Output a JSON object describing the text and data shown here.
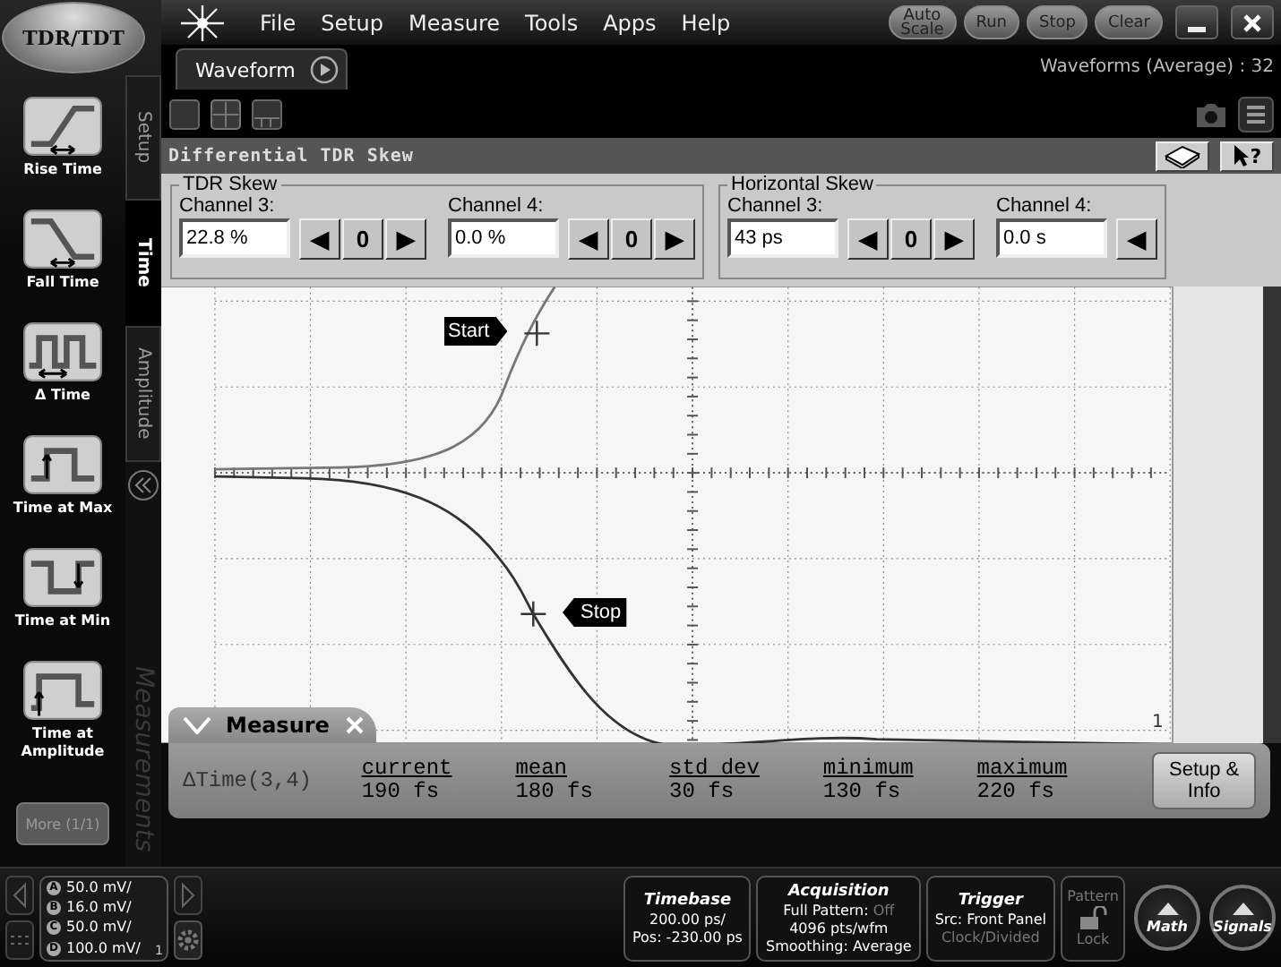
{
  "app_button": "TDR/TDT",
  "menu": [
    "File",
    "Setup",
    "Measure",
    "Tools",
    "Apps",
    "Help"
  ],
  "run_controls": [
    "Auto Scale",
    "Run",
    "Stop",
    "Clear"
  ],
  "measurement_buttons": [
    {
      "label": "Rise Time",
      "kind": "rise"
    },
    {
      "label": "Fall Time",
      "kind": "fall"
    },
    {
      "label": "Δ Time",
      "kind": "delta"
    },
    {
      "label": "Time at Max",
      "kind": "max"
    },
    {
      "label": "Time at Min",
      "kind": "min"
    },
    {
      "label": "Time at Amplitude",
      "kind": "amplitude"
    }
  ],
  "more_button": {
    "label": "More (1/1)",
    "disabled": true
  },
  "side_tabs": [
    {
      "label": "Setup",
      "selected": false
    },
    {
      "label": "Time",
      "selected": true
    },
    {
      "label": "Amplitude",
      "selected": false
    }
  ],
  "sidebar_caption": "Measurements",
  "waveform_tab": "Waveform",
  "waveform_count": "Waveforms (Average) : 32",
  "dialog": {
    "title": "Differential TDR Skew",
    "help": "?",
    "groups": [
      {
        "title": "TDR Skew",
        "channels": [
          {
            "label": "Channel 3:",
            "value": "22.8 %",
            "buttons": [
              "◀",
              "0",
              "▶"
            ]
          },
          {
            "label": "Channel 4:",
            "value": "0.0 %",
            "buttons": [
              "◀",
              "0",
              "▶"
            ]
          }
        ]
      },
      {
        "title": "Horizontal Skew",
        "channels": [
          {
            "label": "Channel 3:",
            "value": "43 ps",
            "buttons": [
              "◀",
              "0",
              "▶"
            ]
          },
          {
            "label": "Channel 4:",
            "value": "0.0 s",
            "buttons": [
              "◀"
            ]
          }
        ]
      }
    ]
  },
  "markers": [
    {
      "label": "Start",
      "kind": "start"
    },
    {
      "label": "Stop",
      "kind": "stop"
    }
  ],
  "trace_end_label": "1",
  "measure": {
    "title": "Measure",
    "row_label": "ΔTime(3,4)",
    "columns": [
      {
        "header": "current",
        "value": "190 fs"
      },
      {
        "header": "mean",
        "value": "180 fs"
      },
      {
        "header": "std dev",
        "value": "30 fs"
      },
      {
        "header": "minimum",
        "value": "130 fs"
      },
      {
        "header": "maximum",
        "value": "220 fs"
      }
    ],
    "setup_button": "Setup & Info"
  },
  "status_bar": {
    "channels": [
      {
        "badge": "A",
        "scale": "50.0 mV/"
      },
      {
        "badge": "B",
        "scale": "16.0 mV/"
      },
      {
        "badge": "C",
        "scale": "50.0 mV/"
      },
      {
        "badge": "D",
        "scale": "100.0 mV/"
      }
    ],
    "page": "1",
    "panels": [
      {
        "title": "Timebase",
        "lines": [
          [
            {
              "text": "200.00 ps/",
              "disabled": false
            }
          ],
          [
            {
              "text": "Pos: -230.00 ps",
              "disabled": false
            }
          ]
        ]
      },
      {
        "title": "Acquisition",
        "lines": [
          [
            {
              "text": "Full Pattern: ",
              "disabled": false
            },
            {
              "text": "Off",
              "disabled": true
            }
          ],
          [
            {
              "text": "4096 pts/wfm",
              "disabled": false
            }
          ],
          [
            {
              "text": "Smoothing: Average",
              "disabled": false
            }
          ]
        ]
      },
      {
        "title": "Trigger",
        "lines": [
          [
            {
              "text": "Src: Front Panel",
              "disabled": false
            }
          ],
          [
            {
              "text": "Clock/Divided",
              "disabled": true
            }
          ]
        ]
      }
    ],
    "pattern": {
      "title": "Pattern",
      "label": "Lock",
      "disabled": true
    },
    "math_button": "Math",
    "signals_button": "Signals"
  }
}
